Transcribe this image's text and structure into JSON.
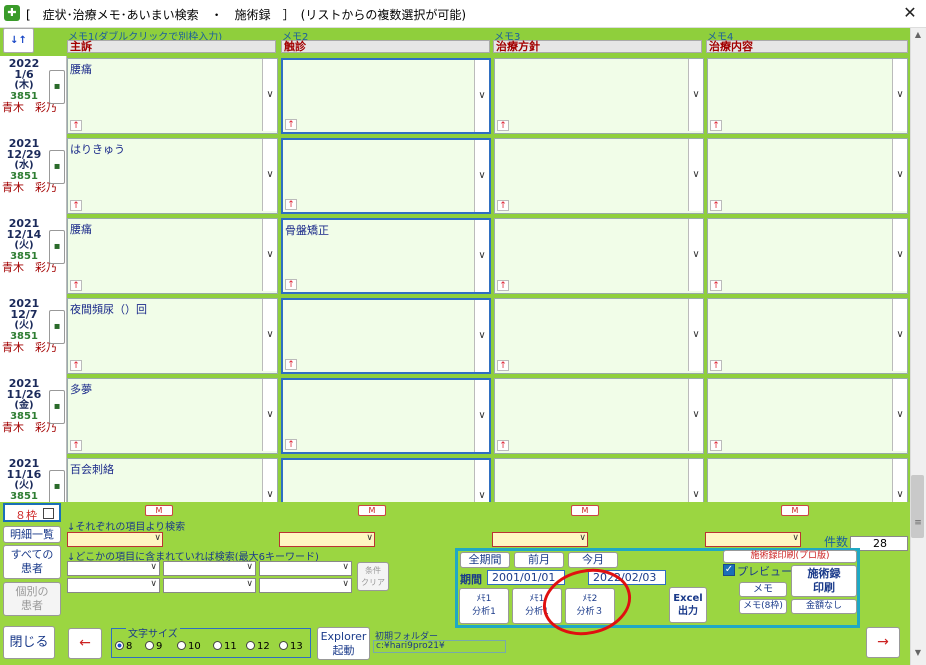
{
  "window": {
    "title": "[　症状･治療メモ･あいまい検索　・　施術録　］　(リストからの複数選択が可能)",
    "close_glyph": "✕"
  },
  "header": {
    "sort_label": "↓↑",
    "memos": [
      {
        "caption": "メモ1(ダブルクリックで別枠入力)",
        "head": "主訴"
      },
      {
        "caption": "メモ2",
        "head": "触診"
      },
      {
        "caption": "メモ3",
        "head": "治療方針"
      },
      {
        "caption": "メモ4",
        "head": "治療内容"
      }
    ]
  },
  "rows": [
    {
      "year": "2022",
      "md": "1/6",
      "wd": "(木)",
      "id": "3851",
      "name": "青木　彩乃",
      "memo1": "腰痛",
      "memo2": ""
    },
    {
      "year": "2021",
      "md": "12/29",
      "wd": "(水)",
      "id": "3851",
      "name": "青木　彩乃",
      "memo1": "はりきゅう",
      "memo2": ""
    },
    {
      "year": "2021",
      "md": "12/14",
      "wd": "(火)",
      "id": "3851",
      "name": "青木　彩乃",
      "memo1": "腰痛",
      "memo2": "骨盤矯正"
    },
    {
      "year": "2021",
      "md": "12/7",
      "wd": "(火)",
      "id": "3851",
      "name": "青木　彩乃",
      "memo1": "夜間頻尿（）回",
      "memo2": ""
    },
    {
      "year": "2021",
      "md": "11/26",
      "wd": "(金)",
      "id": "3851",
      "name": "青木　彩乃",
      "memo1": "多夢",
      "memo2": ""
    },
    {
      "year": "2021",
      "md": "11/16",
      "wd": "(火)",
      "id": "3851",
      "name": "",
      "memo1": "百会刺絡",
      "memo2": ""
    }
  ],
  "row_widgets": {
    "dot": "▪",
    "arrow": "↑",
    "chevron": "∨"
  },
  "bottom": {
    "eight_frame_label": "８枠",
    "m_label": "M",
    "search_each_label": "↓それぞれの項目より検索",
    "search_any_label": "↓どこかの項目に含まれていれば検索(最大6キーワード)",
    "detail_list_btn": "明細一覧",
    "all_patients_btn": [
      "すべての",
      "患者"
    ],
    "each_patient_btn": [
      "個別の",
      "患者"
    ],
    "condition_clear_btn": [
      "条件",
      "クリア"
    ],
    "count_label": "件数",
    "count_value": "28",
    "period": {
      "all_btn": "全期間",
      "prev_btn": "前月",
      "this_btn": "今月",
      "label": "期間",
      "from": "2001/01/01",
      "to": "2022/02/03"
    },
    "analysis": [
      {
        "top": "ﾒﾓ1",
        "bottom": "分析1"
      },
      {
        "top": "ﾒﾓ1",
        "bottom": "分析1"
      },
      {
        "top": "ﾒﾓ2",
        "bottom": "分析３"
      }
    ],
    "excel_btn": [
      "Excel",
      "出力"
    ],
    "print_head": "施術録印刷(プロ版)",
    "preview_label": "プレビュー",
    "memo_btn": "メモ",
    "memo8_btn": "メモ(8枠)",
    "sejutsu_btn": [
      "施術録",
      "印刷"
    ],
    "no_amount_btn": "金額なし",
    "close_btn": "閉じる",
    "left_arrow": "←",
    "right_arrow": "→",
    "font_size_label": "文字サイズ",
    "font_sizes": [
      "8",
      "9",
      "10",
      "11",
      "12",
      "13"
    ],
    "explorer_btn": [
      "Explorer",
      "起動"
    ],
    "init_folder_label": "初期フォルダー",
    "init_folder_value": "c:¥hari9pro21¥"
  }
}
